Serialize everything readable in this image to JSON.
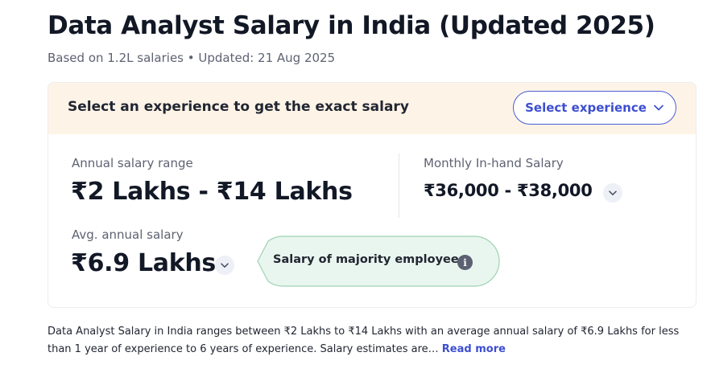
{
  "header": {
    "title": "Data Analyst Salary in India (Updated 2025)",
    "subtitle": "Based on 1.2L salaries • Updated: 21 Aug 2025"
  },
  "experience_bar": {
    "prompt": "Select an experience to get the exact salary",
    "button_label": "Select experience"
  },
  "salary": {
    "annual_range_label": "Annual salary range",
    "annual_range_value": "₹2 Lakhs - ₹14 Lakhs",
    "monthly_label": "Monthly In-hand Salary",
    "monthly_value": "₹36,000 - ₹38,000",
    "avg_label": "Avg. annual salary",
    "avg_value": "₹6.9 Lakhs",
    "tooltip": "Salary of majority employees"
  },
  "description": {
    "text": "Data Analyst Salary in India ranges between ₹2 Lakhs to ₹14 Lakhs with an average annual salary of ₹6.9 Lakhs for less than 1 year of experience to 6 years of experience. Salary estimates are… ",
    "read_more": "Read more"
  },
  "colors": {
    "accent": "#3d4ed0",
    "header_bg": "#fdf4e7",
    "tooltip_bg": "#e9f6ef",
    "tooltip_border": "#9fd2b3"
  },
  "icons": [
    "chevron-down-icon",
    "chevron-down-icon",
    "chevron-down-icon",
    "info-icon"
  ]
}
